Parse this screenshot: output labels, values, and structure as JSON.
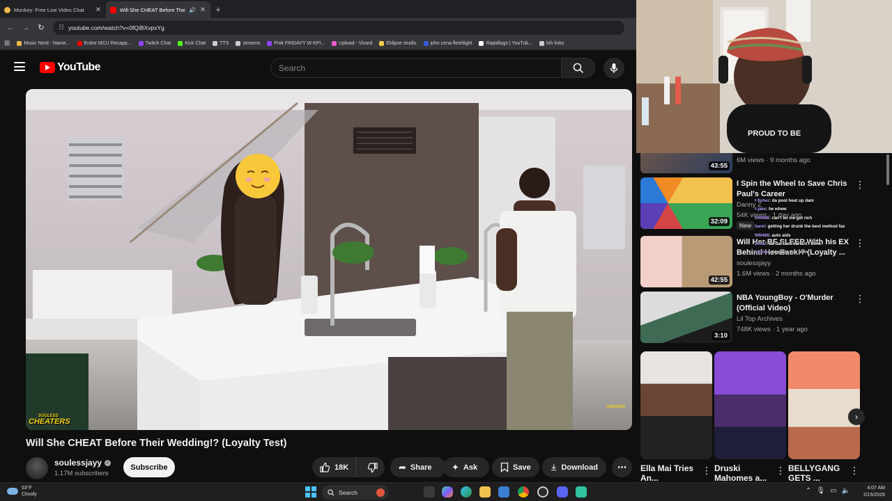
{
  "browser": {
    "tabs": [
      {
        "title": "Monkey: Free Live Video Chat",
        "active": false,
        "favicon_color": "#f2b84b"
      },
      {
        "title": "Will She CHEAT Before Their",
        "active": true,
        "favicon_color": "#ff0000"
      }
    ],
    "url": "youtube.com/watch?v=0fQiBXvpxYg",
    "bookmarks": [
      {
        "label": "Music Nerd - Name...",
        "color": "#f2b84b"
      },
      {
        "label": "Entire MCU Recapp...",
        "color": "#ff0000"
      },
      {
        "label": "Twitch Chat",
        "color": "#9146ff"
      },
      {
        "label": "Kick Chat",
        "color": "#53fc18"
      },
      {
        "label": "TTS",
        "color": "#cccccc"
      },
      {
        "label": "streams",
        "color": "#cccccc"
      },
      {
        "label": "Pink FRIDAYY W KPI...",
        "color": "#9146ff"
      },
      {
        "label": "Upload - Vizard",
        "color": "#e85ccf"
      },
      {
        "label": "Eklipse studio",
        "color": "#f2c94c"
      },
      {
        "label": "john cena fleshlight",
        "color": "#3b5bdb"
      },
      {
        "label": "Rapidtags | YouTub...",
        "color": "#ffffff"
      },
      {
        "label": "bih links",
        "color": "#cccccc"
      }
    ]
  },
  "youtube": {
    "logo_text": "YouTube",
    "search_placeholder": "Search",
    "video": {
      "title": "Will She CHEAT Before Their Wedding!? (Loyalty Test)",
      "brand_top": "SOULESS",
      "brand_bottom": "CHEATERS",
      "watermark": "CHEATERS"
    },
    "channel": {
      "name": "soulessjayy",
      "subscribers": "1.17M subscribers"
    },
    "subscribe_label": "Subscribe",
    "actions": {
      "likes": "18K",
      "share": "Share",
      "ask": "Ask",
      "save": "Save",
      "download": "Download"
    }
  },
  "sidebar": {
    "recommendations": [
      {
        "title": "",
        "channel": "",
        "meta": "6M views · 9 months ago",
        "duration": "43:55"
      },
      {
        "title": "I Spin the Wheel to Save Chris Paul's Career",
        "channel": "Danny Z",
        "meta": "54K views · 1 day ago",
        "badge": "New",
        "duration": "32:09"
      },
      {
        "title": "Will Her BF SLEEP With his EX Behind Her Back!? (Loyalty ...",
        "channel": "soulessjayy",
        "meta": "1.6M views · 2 months ago",
        "duration": "42:55"
      },
      {
        "title": "NBA YoungBoy - O'Murder (Official Video)",
        "channel": "Lil Top Archives",
        "meta": "748K views · 1 year ago",
        "duration": "3:10"
      }
    ],
    "shorts": [
      {
        "title": "Ella Mai Tries An..."
      },
      {
        "title": "Druski Mahomes a..."
      },
      {
        "title": "BELLYGANG GETS ..."
      }
    ]
  },
  "chat_overlay": [
    {
      "user": "t·fisher",
      "text": ": da pool heat up dam"
    },
    {
      "user": "t·jake",
      "text": ": he whew"
    },
    {
      "user": "NW488",
      "text": ": can't let me get rich"
    },
    {
      "user": "harel",
      "text": ": getting her drunk the best method fax"
    },
    {
      "user": "NW488",
      "text": ": auto aids"
    },
    {
      "user": "dcnaf",
      "text": ": da dat caro variant i think"
    },
    {
      "user": "t·fisher",
      "text": ": nigga is this porn"
    }
  ],
  "taskbar": {
    "weather_temp": "53°F",
    "weather_desc": "Cloudy",
    "search_label": "Search",
    "time": "4:07 AM",
    "date": "2/15/2026"
  }
}
